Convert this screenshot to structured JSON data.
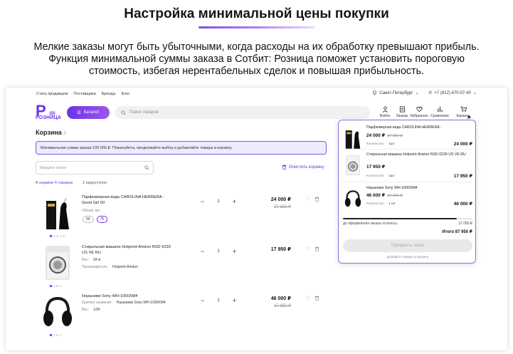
{
  "hero": {
    "title": "Настройка минимальной цены покупки",
    "description": "Мелкие заказы могут быть убыточными, когда расходы на их обработку превышают прибыль. Функция минимальной суммы заказа в Сотбит: Розница поможет установить пороговую стоимость, избегая нерентабельных сделок и повышая прибыльность."
  },
  "topbar": {
    "links": [
      "Стать продавцом",
      "Поставщики",
      "Бренды",
      "Блог"
    ],
    "city": "Санкт-Петербург",
    "phone": "+7 (812) 670-07-40"
  },
  "header": {
    "logo_text": "РОЗНИЦА",
    "logo_badge": "2.0",
    "catalog_label": "Каталог",
    "search_placeholder": "Поиск товаров",
    "icons": [
      {
        "label": "Войти",
        "icon": "user-icon"
      },
      {
        "label": "Заказы",
        "icon": "orders-icon"
      },
      {
        "label": "Избранное",
        "icon": "heart-icon"
      },
      {
        "label": "Сравнение",
        "icon": "compare-icon"
      },
      {
        "label": "Корзина",
        "icon": "cart-icon"
      }
    ]
  },
  "cart": {
    "title": "Корзина",
    "count": "3",
    "notice": "Минимальная сумма заказа 100 000 ₽. Пожалуйста, продолжайте выбор и добавляйте товары в корзину.",
    "promo_placeholder": "Введите купон",
    "clear_label": "Очистить корзину",
    "filter_in_cart": "В корзине 6 товаров",
    "filter_unavailable": "2 недоступно",
    "items": [
      {
        "name": "Парфюмерная вода CAROLINA HERRERA - Good Girl 50",
        "attr_label": "Объем, мл:",
        "volumes": [
          "50",
          "75"
        ],
        "qty": "1",
        "price": "24 000 ₽",
        "old_price": "37 950 ₽"
      },
      {
        "name": "Стиральная машина Hotpoint-Ariston NSD 6239 US VE RU",
        "attr1_label": "Вес:",
        "attr1_value": "34 кг",
        "attr2_label": "Производитель:",
        "attr2_value": "Hotpoint-Ariston",
        "qty": "1",
        "price": "17 950 ₽"
      },
      {
        "name": "Наушники Sony WH-1000XM4",
        "attr1_label": "Краткое название:",
        "attr1_value": "Наушники Sony WH-1000XM4",
        "attr2_label": "Вес:",
        "attr2_value": "120г",
        "qty": "1",
        "price": "46 000 ₽",
        "old_price": "37 950 ₽"
      }
    ]
  },
  "mini_cart": {
    "qty_label": "Количество:",
    "items": [
      {
        "name": "Парфюмерная вода CAROLINA HERRERA -",
        "price": "24 000 ₽",
        "old_price": "37 950 ₽",
        "qty": "1шт",
        "total": "24 000 ₽"
      },
      {
        "name": "Стиральная машина Hotpoint-Ariston NSD 6239 US VE RU",
        "price": "17 950 ₽",
        "qty": "1шт",
        "total": "17 950 ₽"
      },
      {
        "name": "Наушники Sony WH-1000XM4",
        "price": "46 000 ₽",
        "old_price": "37 950 ₽",
        "qty": "1 шт",
        "total": "46 000 ₽"
      }
    ],
    "progress_fraction": 0.88,
    "remaining_label": "до оформления заказа осталось",
    "remaining_value": "12 050 ₽",
    "total_label": "Итого 87 950 ₽",
    "checkout_label": "Оформить заказ",
    "hint": "Добавьте товары в корзину"
  },
  "colors": {
    "accent": "#6d31e8",
    "notice_bg": "#efeaff",
    "notice_border": "#7c5bd9"
  }
}
